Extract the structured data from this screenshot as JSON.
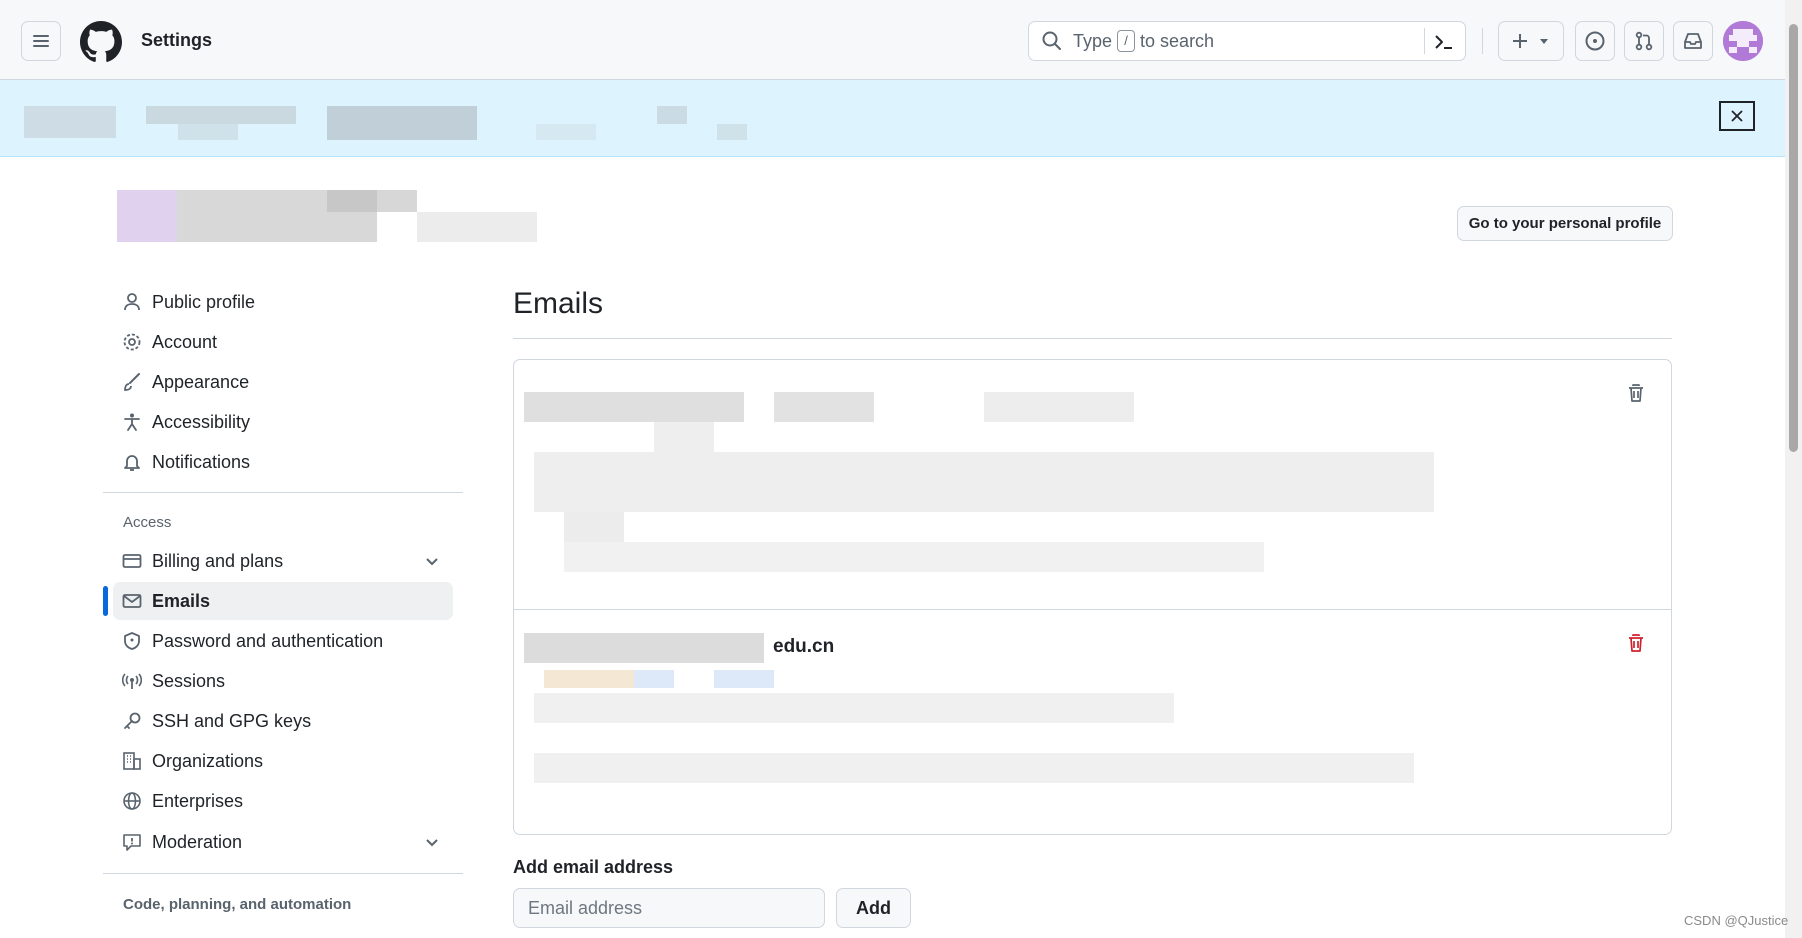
{
  "header": {
    "title": "Settings",
    "search": {
      "prefix": "Type",
      "key": "/",
      "suffix": "to search"
    }
  },
  "profile": {
    "go_to_profile_label": "Go to your personal profile"
  },
  "sidebar": {
    "items": [
      {
        "label": "Public profile",
        "icon": "person-icon"
      },
      {
        "label": "Account",
        "icon": "gear-icon"
      },
      {
        "label": "Appearance",
        "icon": "paintbrush-icon"
      },
      {
        "label": "Accessibility",
        "icon": "accessibility-icon"
      },
      {
        "label": "Notifications",
        "icon": "bell-icon"
      }
    ],
    "access_label": "Access",
    "access_items": [
      {
        "label": "Billing and plans",
        "icon": "credit-card-icon"
      },
      {
        "label": "Emails",
        "icon": "mail-icon",
        "active": true
      },
      {
        "label": "Password and authentication",
        "icon": "shield-icon"
      },
      {
        "label": "Sessions",
        "icon": "broadcast-icon"
      },
      {
        "label": "SSH and GPG keys",
        "icon": "key-icon"
      },
      {
        "label": "Organizations",
        "icon": "organization-icon"
      },
      {
        "label": "Enterprises",
        "icon": "globe-icon"
      },
      {
        "label": "Moderation",
        "icon": "report-icon"
      }
    ],
    "code_section_label": "Code, planning, and automation"
  },
  "main": {
    "title": "Emails",
    "emails": [
      {
        "address_visible_suffix": ""
      },
      {
        "address_visible_suffix": "edu.cn"
      }
    ],
    "add_email": {
      "label": "Add email address",
      "placeholder": "Email address",
      "button": "Add"
    }
  },
  "watermark": "CSDN @QJustice",
  "colors": {
    "accent": "#0969da",
    "banner": "#ddf4ff",
    "danger": "#cf222e",
    "avatar": "#b07ad6"
  }
}
